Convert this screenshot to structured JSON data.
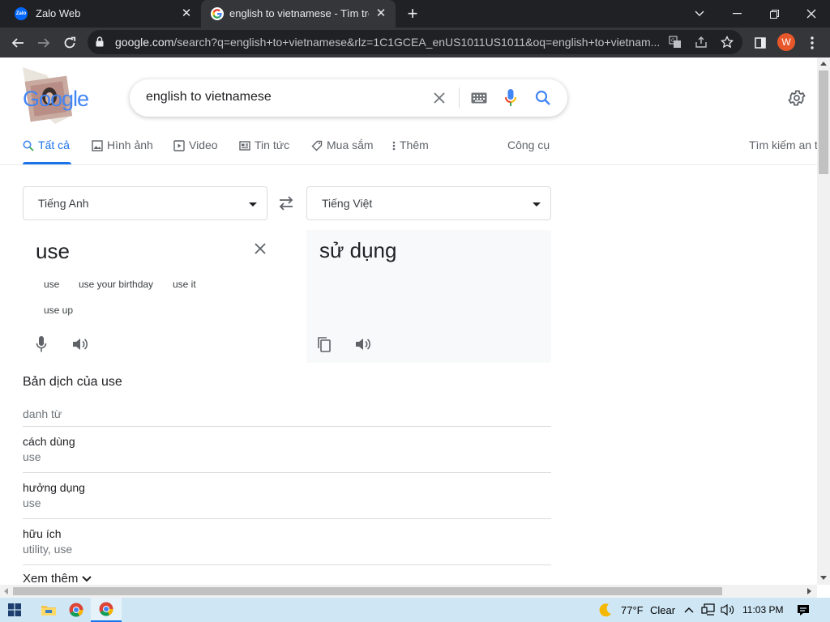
{
  "browser": {
    "tabs": [
      {
        "title": "Zalo Web",
        "favicon_text": "Zalo"
      },
      {
        "title": "english to vietnamese - Tìm trên",
        "favicon": "google-g-icon"
      }
    ],
    "url_host": "google.com",
    "url_path": "/search?q=english+to+vietnamese&rlz=1C1GCEA_enUS1011US1011&oq=english+to+vietnam...",
    "profile_initial": "W"
  },
  "search": {
    "logo_text": "Google",
    "query": "english to vietnamese"
  },
  "nav_tabs": [
    {
      "label": "Tất cả",
      "icon": "search-icon"
    },
    {
      "label": "Hình ảnh",
      "icon": "image-icon"
    },
    {
      "label": "Video",
      "icon": "play-icon"
    },
    {
      "label": "Tin tức",
      "icon": "news-icon"
    },
    {
      "label": "Mua sắm",
      "icon": "tag-icon"
    },
    {
      "label": "Thêm",
      "icon": "more-vert-icon"
    },
    {
      "label": "Công cụ"
    },
    {
      "label": "Tìm kiếm an t"
    }
  ],
  "translate": {
    "source_lang": "Tiếng Anh",
    "target_lang": "Tiếng Việt",
    "source_text": "use",
    "target_text": "sử dụng",
    "suggestions": [
      "use",
      "use your birthday",
      "use it",
      "use up"
    ]
  },
  "definitions": {
    "title": "Bản dịch của use",
    "part_of_speech": "danh từ",
    "entries": [
      {
        "word": "cách dùng",
        "synonyms": "use"
      },
      {
        "word": "hưởng dụng",
        "synonyms": "use"
      },
      {
        "word": "hữu ích",
        "synonyms": "utility, use"
      }
    ],
    "more_label": "Xem thêm"
  },
  "taskbar": {
    "temperature": "77°F",
    "weather": "Clear",
    "time": "11:03 PM"
  },
  "colors": {
    "accent": "#1a73e8",
    "chrome_dark": "#202124",
    "chrome_toolbar": "#35363a",
    "taskbar": "#cfe7f5"
  }
}
